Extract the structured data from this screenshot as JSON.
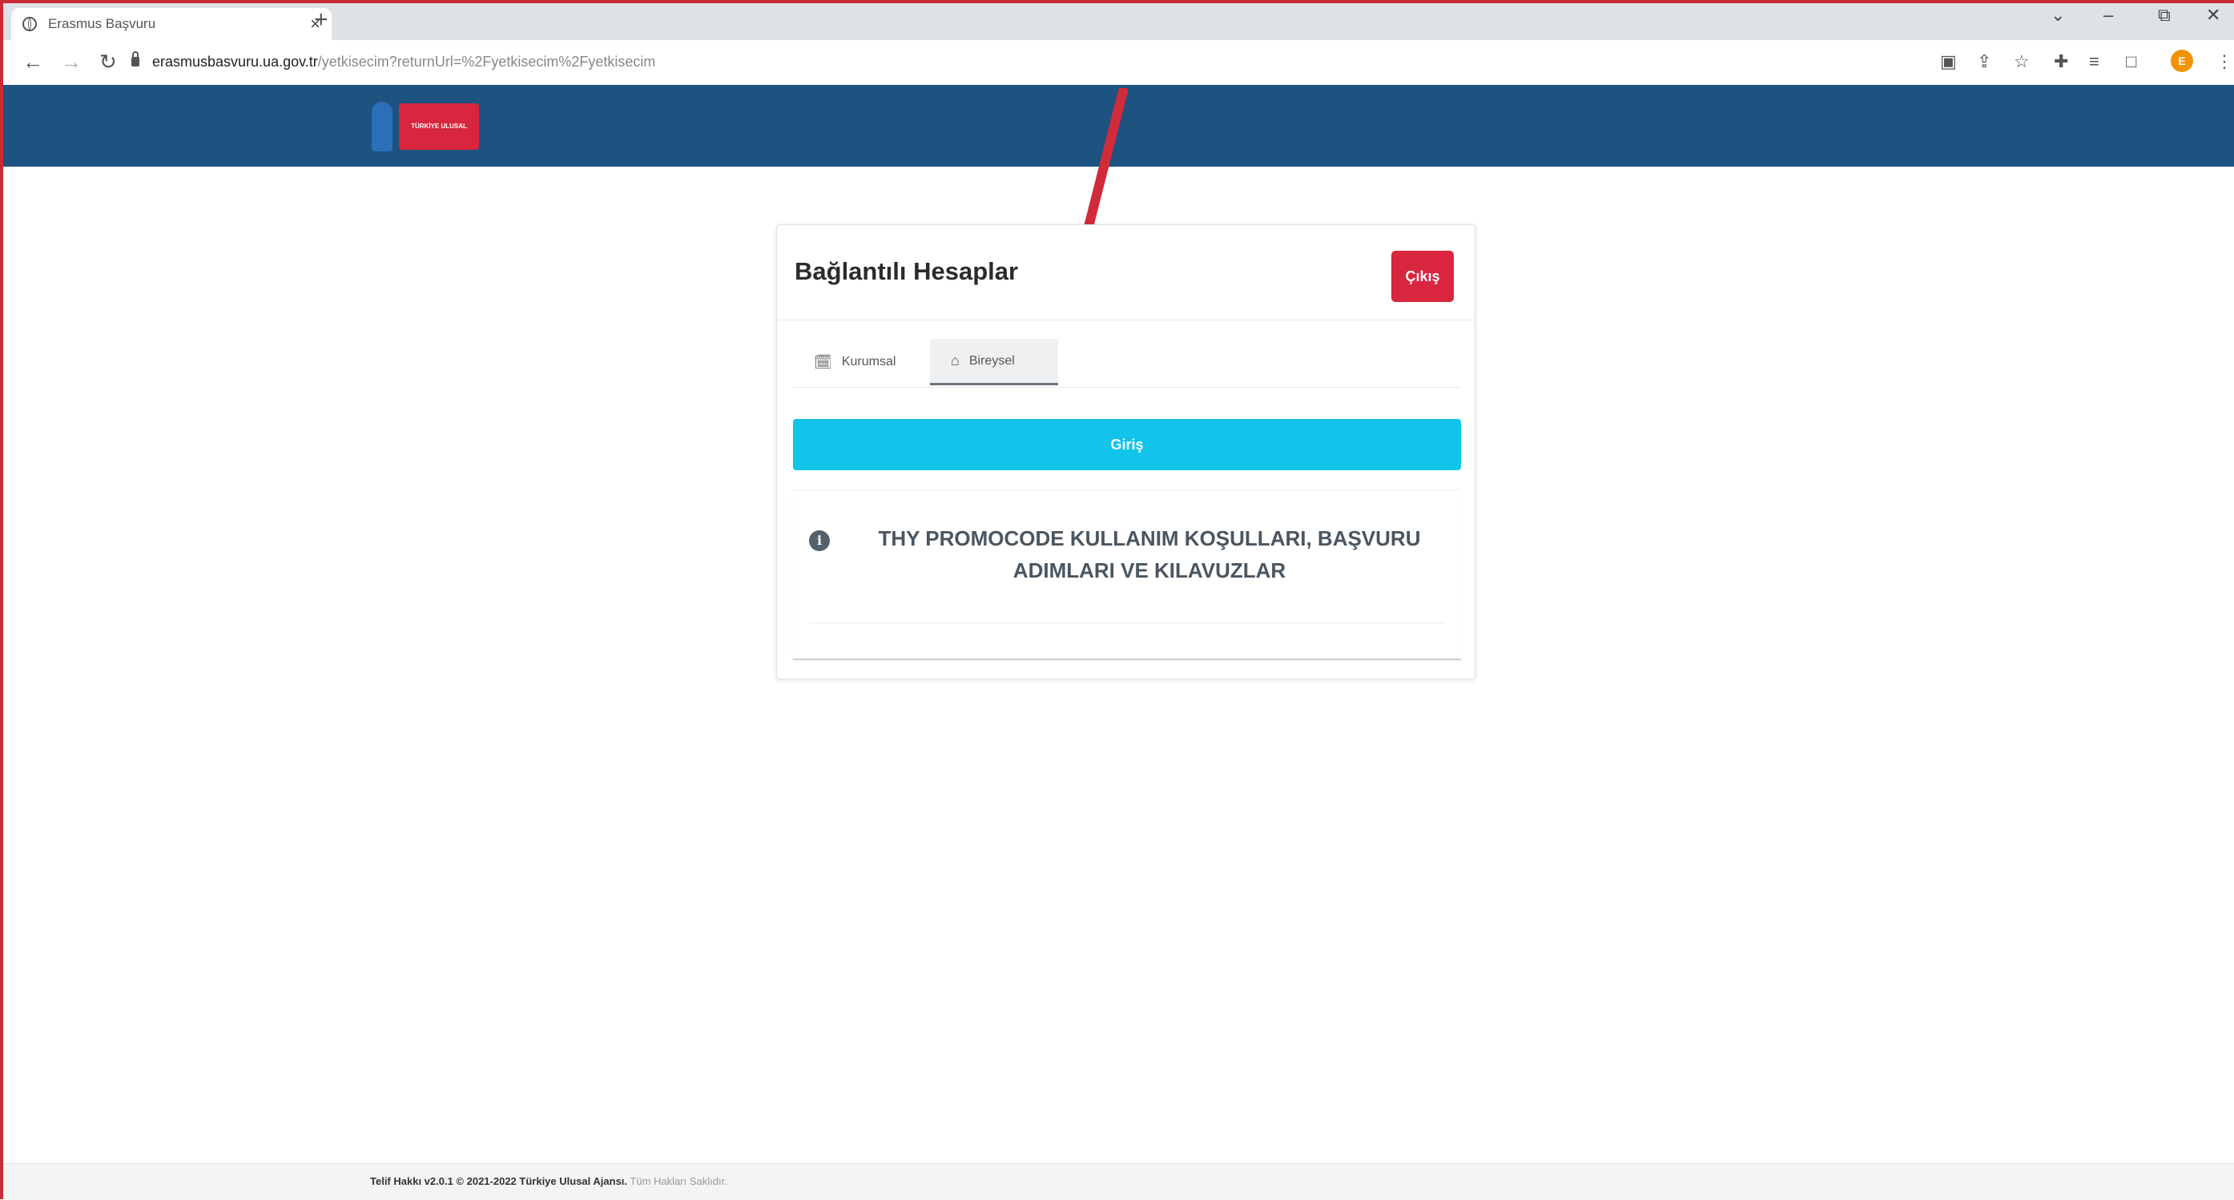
{
  "browser": {
    "tab_title": "Erasmus Başvuru",
    "tab_close": "×",
    "new_tab": "+",
    "window_controls": [
      "⌄",
      "–",
      "⧉",
      "✕"
    ],
    "url_host": "erasmusbasvuru.ua.gov.tr",
    "url_path": "/yetkisecim?returnUrl=%2Fyetkisecim%2Fyetkisecim",
    "profile_initial": "E"
  },
  "header": {
    "logo_text": "TÜRKİYE ULUSAL AJANSI"
  },
  "card": {
    "title": "Bağlantılı Hesaplar",
    "logout_label": "Çıkış",
    "tabs": [
      {
        "label": "Kurumsal",
        "icon": "calendar-icon"
      },
      {
        "label": "Bireysel",
        "icon": "home-icon"
      }
    ],
    "login_label": "Giriş",
    "info_text": "THY PROMOCODE KULLANIM KOŞULLARI, BAŞVURU ADIMLARI VE KILAVUZLAR"
  },
  "footer": {
    "copyright": "Telif Hakkı v2.0.1 © 2021-2022 Türkiye Ulusal Ajansı.",
    "rights": "Tüm Hakları Saklıdır."
  },
  "colors": {
    "header_bg": "#1e5280",
    "logout_bg": "#d7263d",
    "login_bg": "#12c4ea",
    "annotation_arrow": "#d12b3a"
  }
}
